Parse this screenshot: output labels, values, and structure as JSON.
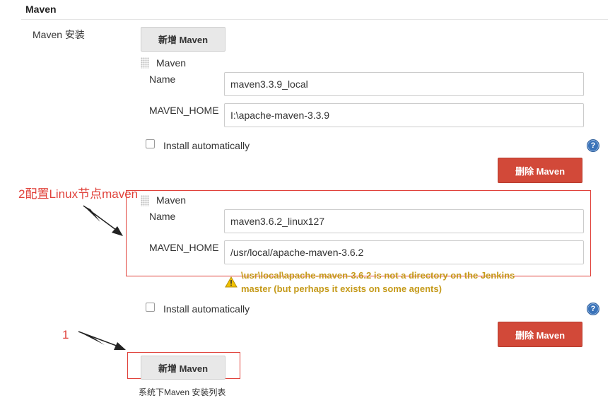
{
  "section": {
    "title": "Maven",
    "installs_label": "Maven 安装"
  },
  "top_add_button": "新增 Maven",
  "installations": [
    {
      "header": "Maven",
      "name_label": "Name",
      "name_value": "maven3.3.9_local",
      "home_label": "MAVEN_HOME",
      "home_value": "I:\\apache-maven-3.3.9",
      "install_label": "Install automatically",
      "help": "?",
      "delete_button": "删除 Maven"
    },
    {
      "header": "Maven",
      "name_label": "Name",
      "name_value": "maven3.6.2_linux127",
      "home_label": "MAVEN_HOME",
      "home_value": "/usr/local/apache-maven-3.6.2",
      "warning_line1": "\\usr\\local\\apache-maven-3.6.2 is not a directory on the Jenkins",
      "warning_line2": "master (but perhaps it exists on some agents)",
      "install_label": "Install automatically",
      "help": "?",
      "delete_button": "删除 Maven"
    }
  ],
  "bottom_add_button": "新增 Maven",
  "footer_note": "系统下Maven 安装列表",
  "annotations": {
    "note_2": "2配置Linux节点maven",
    "note_1": "1"
  },
  "colors": {
    "accent_red": "#d24939",
    "annotation_red": "#e0413a",
    "warning": "#c59a1a",
    "help_blue": "#3a73b9"
  },
  "icons": {
    "drag": "drag-handle-icon",
    "help": "help-icon",
    "warning": "warning-icon",
    "arrow": "arrow-icon"
  }
}
